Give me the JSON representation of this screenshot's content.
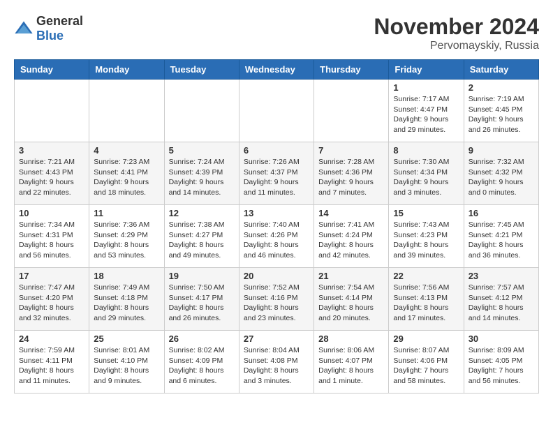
{
  "logo": {
    "general": "General",
    "blue": "Blue"
  },
  "header": {
    "month": "November 2024",
    "location": "Pervomayskiy, Russia"
  },
  "weekdays": [
    "Sunday",
    "Monday",
    "Tuesday",
    "Wednesday",
    "Thursday",
    "Friday",
    "Saturday"
  ],
  "weeks": [
    [
      {
        "day": "",
        "info": ""
      },
      {
        "day": "",
        "info": ""
      },
      {
        "day": "",
        "info": ""
      },
      {
        "day": "",
        "info": ""
      },
      {
        "day": "",
        "info": ""
      },
      {
        "day": "1",
        "info": "Sunrise: 7:17 AM\nSunset: 4:47 PM\nDaylight: 9 hours and 29 minutes."
      },
      {
        "day": "2",
        "info": "Sunrise: 7:19 AM\nSunset: 4:45 PM\nDaylight: 9 hours and 26 minutes."
      }
    ],
    [
      {
        "day": "3",
        "info": "Sunrise: 7:21 AM\nSunset: 4:43 PM\nDaylight: 9 hours and 22 minutes."
      },
      {
        "day": "4",
        "info": "Sunrise: 7:23 AM\nSunset: 4:41 PM\nDaylight: 9 hours and 18 minutes."
      },
      {
        "day": "5",
        "info": "Sunrise: 7:24 AM\nSunset: 4:39 PM\nDaylight: 9 hours and 14 minutes."
      },
      {
        "day": "6",
        "info": "Sunrise: 7:26 AM\nSunset: 4:37 PM\nDaylight: 9 hours and 11 minutes."
      },
      {
        "day": "7",
        "info": "Sunrise: 7:28 AM\nSunset: 4:36 PM\nDaylight: 9 hours and 7 minutes."
      },
      {
        "day": "8",
        "info": "Sunrise: 7:30 AM\nSunset: 4:34 PM\nDaylight: 9 hours and 3 minutes."
      },
      {
        "day": "9",
        "info": "Sunrise: 7:32 AM\nSunset: 4:32 PM\nDaylight: 9 hours and 0 minutes."
      }
    ],
    [
      {
        "day": "10",
        "info": "Sunrise: 7:34 AM\nSunset: 4:31 PM\nDaylight: 8 hours and 56 minutes."
      },
      {
        "day": "11",
        "info": "Sunrise: 7:36 AM\nSunset: 4:29 PM\nDaylight: 8 hours and 53 minutes."
      },
      {
        "day": "12",
        "info": "Sunrise: 7:38 AM\nSunset: 4:27 PM\nDaylight: 8 hours and 49 minutes."
      },
      {
        "day": "13",
        "info": "Sunrise: 7:40 AM\nSunset: 4:26 PM\nDaylight: 8 hours and 46 minutes."
      },
      {
        "day": "14",
        "info": "Sunrise: 7:41 AM\nSunset: 4:24 PM\nDaylight: 8 hours and 42 minutes."
      },
      {
        "day": "15",
        "info": "Sunrise: 7:43 AM\nSunset: 4:23 PM\nDaylight: 8 hours and 39 minutes."
      },
      {
        "day": "16",
        "info": "Sunrise: 7:45 AM\nSunset: 4:21 PM\nDaylight: 8 hours and 36 minutes."
      }
    ],
    [
      {
        "day": "17",
        "info": "Sunrise: 7:47 AM\nSunset: 4:20 PM\nDaylight: 8 hours and 32 minutes."
      },
      {
        "day": "18",
        "info": "Sunrise: 7:49 AM\nSunset: 4:18 PM\nDaylight: 8 hours and 29 minutes."
      },
      {
        "day": "19",
        "info": "Sunrise: 7:50 AM\nSunset: 4:17 PM\nDaylight: 8 hours and 26 minutes."
      },
      {
        "day": "20",
        "info": "Sunrise: 7:52 AM\nSunset: 4:16 PM\nDaylight: 8 hours and 23 minutes."
      },
      {
        "day": "21",
        "info": "Sunrise: 7:54 AM\nSunset: 4:14 PM\nDaylight: 8 hours and 20 minutes."
      },
      {
        "day": "22",
        "info": "Sunrise: 7:56 AM\nSunset: 4:13 PM\nDaylight: 8 hours and 17 minutes."
      },
      {
        "day": "23",
        "info": "Sunrise: 7:57 AM\nSunset: 4:12 PM\nDaylight: 8 hours and 14 minutes."
      }
    ],
    [
      {
        "day": "24",
        "info": "Sunrise: 7:59 AM\nSunset: 4:11 PM\nDaylight: 8 hours and 11 minutes."
      },
      {
        "day": "25",
        "info": "Sunrise: 8:01 AM\nSunset: 4:10 PM\nDaylight: 8 hours and 9 minutes."
      },
      {
        "day": "26",
        "info": "Sunrise: 8:02 AM\nSunset: 4:09 PM\nDaylight: 8 hours and 6 minutes."
      },
      {
        "day": "27",
        "info": "Sunrise: 8:04 AM\nSunset: 4:08 PM\nDaylight: 8 hours and 3 minutes."
      },
      {
        "day": "28",
        "info": "Sunrise: 8:06 AM\nSunset: 4:07 PM\nDaylight: 8 hours and 1 minute."
      },
      {
        "day": "29",
        "info": "Sunrise: 8:07 AM\nSunset: 4:06 PM\nDaylight: 7 hours and 58 minutes."
      },
      {
        "day": "30",
        "info": "Sunrise: 8:09 AM\nSunset: 4:05 PM\nDaylight: 7 hours and 56 minutes."
      }
    ]
  ]
}
